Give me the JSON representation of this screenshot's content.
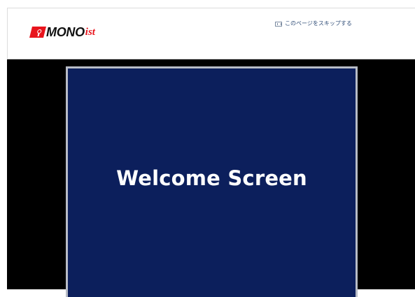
{
  "header": {
    "logo": {
      "brand": "MONO",
      "suffix": "ist"
    },
    "skip_link": {
      "label": "このページをスキップする",
      "icon": "window-icon"
    }
  },
  "main": {
    "welcome_title": "Welcome Screen"
  },
  "colors": {
    "brand_red": "#e8141c",
    "panel_blue": "#0c1f5c",
    "stage_black": "#000000",
    "link_blue": "#33507a"
  }
}
